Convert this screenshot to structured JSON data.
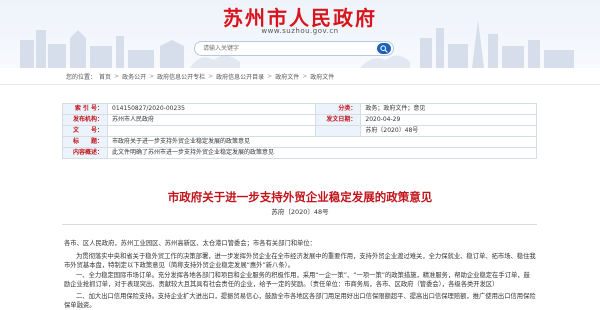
{
  "header": {
    "site_title": "苏州市人民政府",
    "site_url": "www.suzhou.gov.cn",
    "search_placeholder": "请输入关键字",
    "search_icon": "search-icon"
  },
  "breadcrumb": {
    "items": [
      "首页",
      "政务公开",
      "政府信息公开专栏",
      "政府信息公开目录",
      "政府文件",
      "政府文件"
    ]
  },
  "info_table": {
    "index_label": "索 引 号：",
    "index_value": "014150827/2020-00235",
    "category_label": "分类：",
    "category_value": "政务；政府文件；意见",
    "issuer_label": "发布机构：",
    "issuer_value": "苏州市人民政府",
    "date_label": "发文日期：",
    "date_value": "2020-04-29",
    "doc_no_label": "文　　号：",
    "doc_no_value": "苏府〔2020〕48号",
    "title_label": "标　　题：",
    "title_value": "市政府关于进一步支持外贸企业稳定发展的政策意见",
    "content_label": "内容概述：",
    "content_value": "此文件明确了苏州市进一步支持外贸企业稳定发展的政策意见"
  },
  "document": {
    "title": "市政府关于进一步支持外贸企业稳定发展的政策意见",
    "number": "苏府〔2020〕48号",
    "address": "各市、区人民政府，苏州工业园区、苏州高新区、太仓港口管委会；市各有关部门和单位：",
    "para1": "为贯彻落实中央和省关于稳外贸工作的决策部署，进一步发挥外贸企业在全市经济发展中的重要作用，支持外贸企业渡过难关，全力保就业、稳订单、拓市场、稳住我市外贸基本盘，特制定以下政策意见（简称支持外贸企业稳定发展“惠外”新八条）。",
    "para2": "一、全力稳定国际市场订单。充分发挥各地各部门和项目和企业服务的积极作用，采用“一企一策”、“一项一策”的政策措施，精准服务，帮助企业稳定在手订单，鼓励企业抢抓订单，对于表现突出、贡献较大且其具有社会责任的企业，给予一定的奖励。（责任单位：市商务局，各市、区政府（管委会），各级各类开发区）",
    "para3": "二、加大出口信用保险支持。支持企业扩大进出口，提振贸易信心，鼓励全市各地区各部门用足用好出口信保限额超平、提高出口信保理赔额，推广使用出口信用保险保单融资。"
  },
  "colors": {
    "brand_red": "#d8141c",
    "label_red": "#c1151c",
    "search_blue": "#1a63b8",
    "label_bg": "#edf3fb"
  }
}
